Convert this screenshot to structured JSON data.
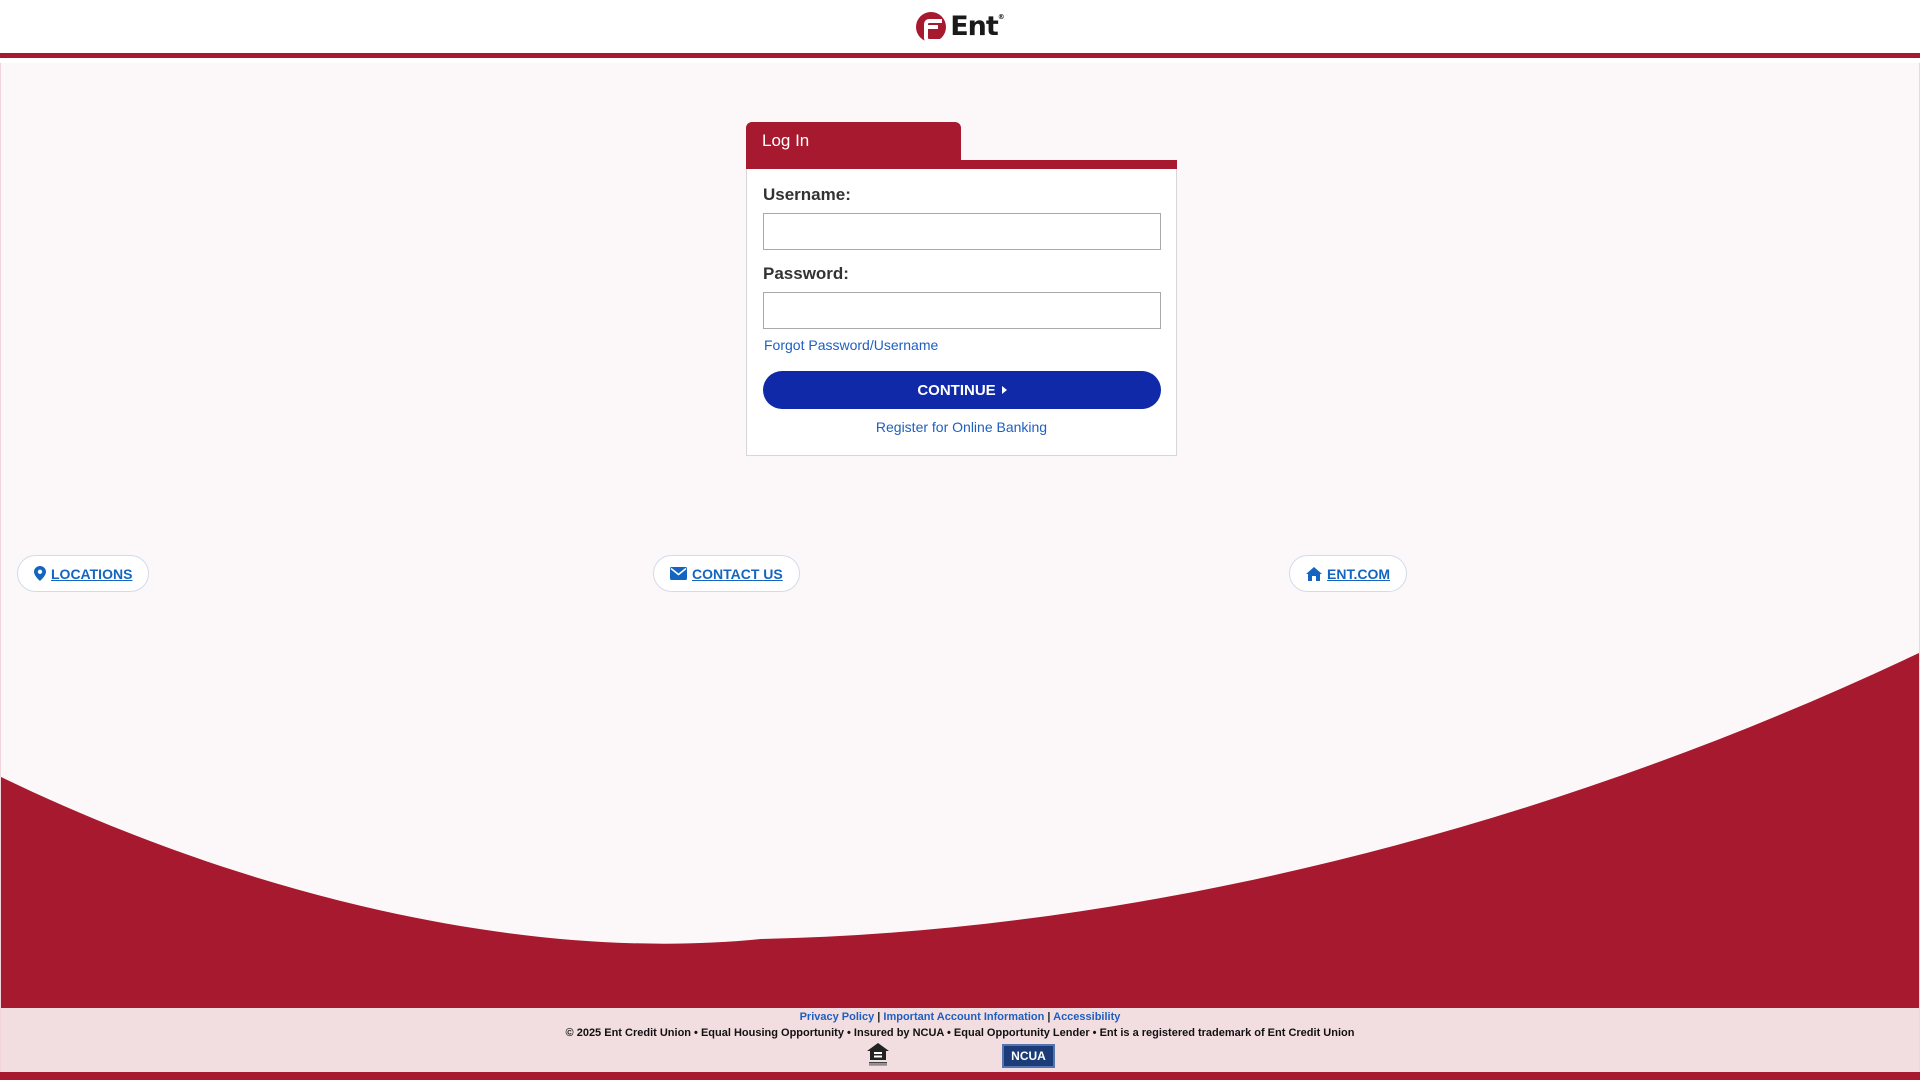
{
  "brand": {
    "name": "Ent",
    "trademark": "®",
    "primary_color": "#a6192e",
    "button_color": "#0f29a8",
    "link_color": "#1f5fbf"
  },
  "login": {
    "tab_title": "Log In",
    "username_label": "Username:",
    "username_value": "",
    "password_label": "Password:",
    "password_value": "",
    "forgot_link": "Forgot Password/Username",
    "continue_label": "CONTINUE",
    "register_link": "Register for Online Banking"
  },
  "quick_links": [
    {
      "label": "LOCATIONS",
      "icon": "map-marker-icon"
    },
    {
      "label": "CONTACT US",
      "icon": "envelope-icon"
    },
    {
      "label": "ENT.COM",
      "icon": "home-icon"
    }
  ],
  "footer": {
    "links": [
      "Privacy Policy",
      "Important Account Information",
      "Accessibility"
    ],
    "separator": "|",
    "copyright": "© 2025 Ent Credit Union • Equal Housing Opportunity • Insured by NCUA • Equal Opportunity Lender • Ent is a registered trademark of Ent Credit Union",
    "ncua_badge": "NCUA",
    "equal_housing_icon": "equal-housing-icon"
  }
}
